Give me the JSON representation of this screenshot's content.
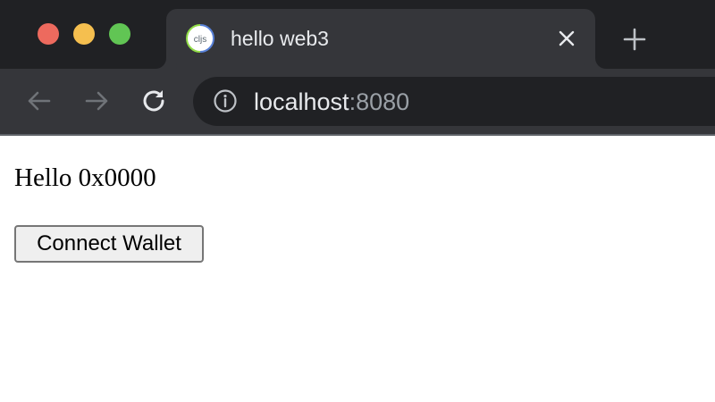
{
  "browser": {
    "tab": {
      "title": "hello web3",
      "favicon_text": "cljs"
    },
    "address_bar": {
      "host": "localhost",
      "port": ":8080"
    },
    "icons": {
      "back": "arrow-left-icon",
      "forward": "arrow-right-icon",
      "reload": "reload-icon",
      "info": "info-icon",
      "close_tab": "close-icon",
      "new_tab": "plus-icon"
    },
    "colors": {
      "titlebar": "#202124",
      "toolbar": "#35363a",
      "close": "#ed6a5e",
      "minimize": "#f5bf4f",
      "zoom": "#61c554"
    }
  },
  "page": {
    "greeting": "Hello 0x0000",
    "connect_button_label": "Connect Wallet"
  }
}
